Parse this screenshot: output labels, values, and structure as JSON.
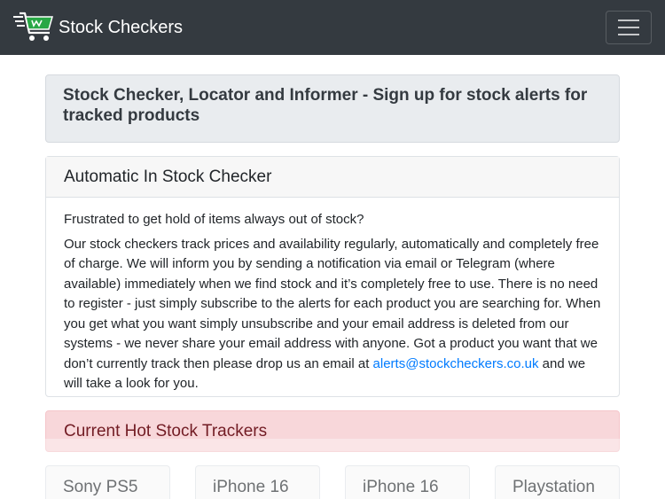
{
  "navbar": {
    "brand_text": "Stock Checkers",
    "logo_icon": "shopping-cart-icon",
    "menu_icon": "hamburger-menu-icon",
    "background": "#343a40",
    "logo_accent": "#28a745"
  },
  "header": {
    "title": "Stock Checker, Locator and Informer - Sign up for stock alerts for tracked products"
  },
  "checker_card": {
    "title": "Automatic In Stock Checker",
    "intro": "Frustrated to get hold of items always out of stock?",
    "body_before_link": "Our stock checkers track prices and availability regularly, automatically and completely free of charge. We will inform you by sending a notification via email or Telegram (where available) immediately when we find stock and it’s completely free to use. There is no need to register - just simply subscribe to the alerts for each product you are searching for. When you get what you want simply unsubscribe and your email address is deleted from our systems - we never share your email address with anyone. Got a product you want that we don’t currently track then please drop us an email at ",
    "email_link": "alerts@stockcheckers.co.uk",
    "body_after_link": " and we will take a look for you."
  },
  "hot_trackers": {
    "title": "Current Hot Stock Trackers",
    "items": [
      {
        "label": "Sony PS5"
      },
      {
        "label": "iPhone 16"
      },
      {
        "label": "iPhone 16"
      },
      {
        "label": "Playstation"
      }
    ]
  }
}
